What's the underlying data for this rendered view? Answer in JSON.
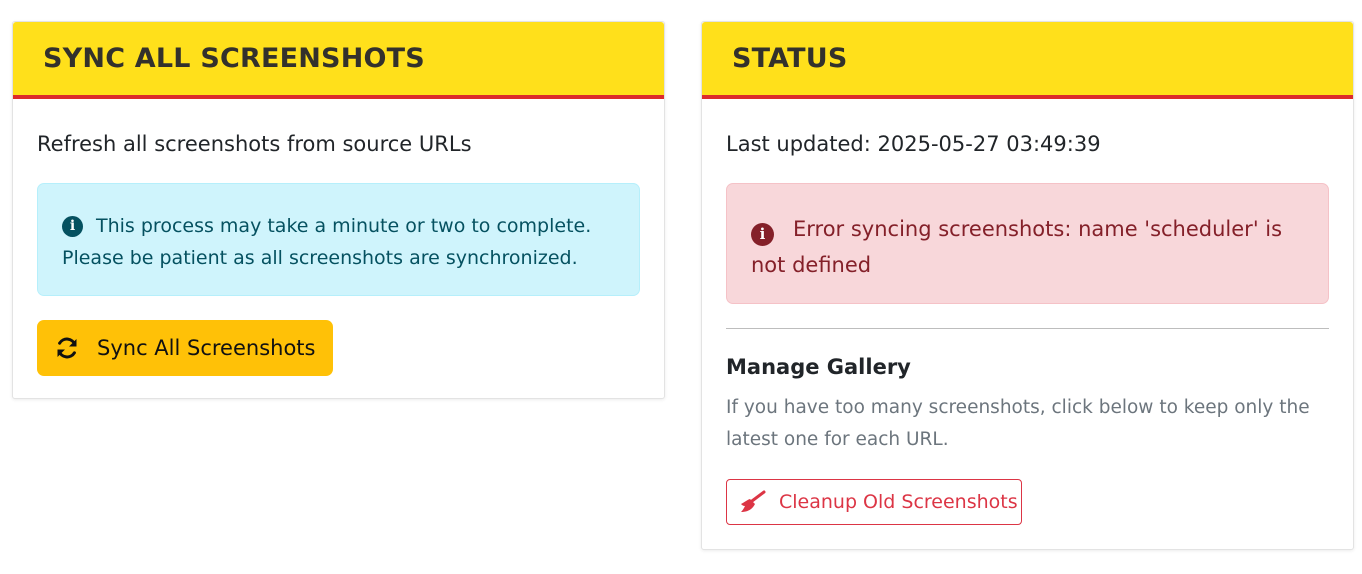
{
  "sync_card": {
    "title": "SYNC ALL SCREENSHOTS",
    "description": "Refresh all screenshots from source URLs",
    "info_line1": "This process may take a minute or two to complete.",
    "info_line2": "Please be patient as all screenshots are synchronized.",
    "info_icon": "info-circle-icon",
    "sync_button_label": "Sync All Screenshots",
    "sync_button_icon": "sync-icon"
  },
  "status_card": {
    "title": "STATUS",
    "last_updated_label": "Last updated:",
    "last_updated_value": "2025-05-27 03:49:39",
    "error_icon": "error-circle-icon",
    "error_message": "Error syncing screenshots: name 'scheduler' is not defined",
    "manage_title": "Manage Gallery",
    "manage_description": "If you have too many screenshots, click below to keep only the latest one for each URL.",
    "cleanup_button_label": "Cleanup Old Screenshots",
    "cleanup_button_icon": "broom-icon"
  },
  "colors": {
    "header_bg": "#ffe01b",
    "header_border": "#dc2b2b",
    "sync_button": "#ffc107",
    "info_bg": "#cff4fc",
    "danger_bg": "#f8d7da",
    "danger_text": "#842029",
    "cleanup_border": "#dc3545"
  }
}
